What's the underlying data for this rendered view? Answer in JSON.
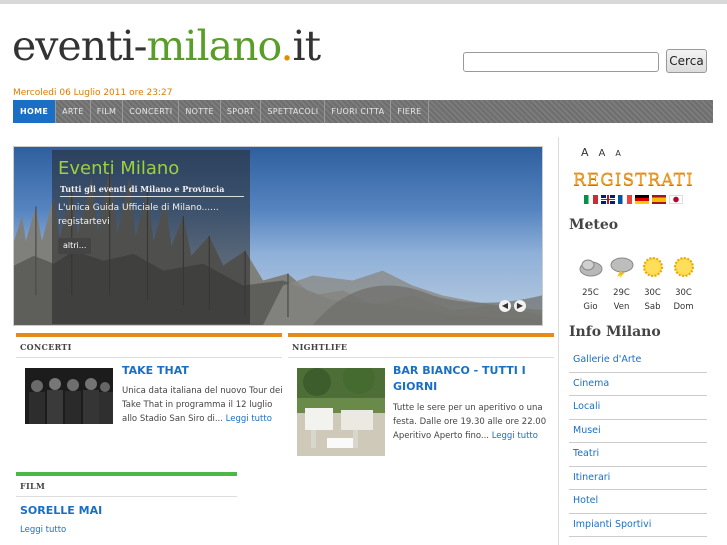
{
  "header": {
    "logo": {
      "part1": "eventi-",
      "part2": "milano",
      "part3": ".",
      "part4": "it"
    },
    "search": {
      "value": "",
      "placeholder": "",
      "button_label": "Cerca"
    },
    "date": "Mercoledi 06 Luglio 2011 ore 23:27"
  },
  "nav": {
    "items": [
      "HOME",
      "ARTE",
      "FILM",
      "CONCERTI",
      "NOTTE",
      "SPORT",
      "SPETTACOLI",
      "FUORI CITTA",
      "FIERE"
    ],
    "active": "HOME"
  },
  "slider": {
    "title": "Eventi Milano",
    "subtitle": "Tutti gli eventi di Milano e Provincia",
    "text": "L'unica Guida Ufficiale di Milano...... registartevi",
    "more_label": "altri...",
    "prev_icon": "◀",
    "next_icon": "▶"
  },
  "sections": {
    "concerti": {
      "heading": "CONCERTI",
      "color": "#e88a1a",
      "title": "TAKE THAT",
      "text": "Unica data italiana del nuovo Tour dei Take That in programma il 12 luglio allo Stadio San Siro di...",
      "more": "Leggi tutto"
    },
    "nightlife": {
      "heading": "NIGHTLIFE",
      "color": "#e88a1a",
      "title": "BAR BIANCO - TUTTI I GIORNI",
      "text": "Tutte le sere per un aperitivo o una festa. Dalle ore 19.30 alle ore 22.00 Aperitivo Aperto fino...",
      "more": "Leggi tutto"
    },
    "film": {
      "heading": "FILM",
      "color": "#4cb848",
      "title": "SORELLE MAI",
      "more": "Leggi tutto"
    }
  },
  "sidebar": {
    "font_sizes": [
      "A",
      "A",
      "A"
    ],
    "registrati": "REGISTRATI",
    "flags": [
      "Italiano",
      "English",
      "Français",
      "Deutsch",
      "Español",
      "日本語"
    ],
    "meteo_title": "Meteo",
    "weather": [
      {
        "temp": "25C",
        "day": "Gio",
        "icon": "cloud-icon"
      },
      {
        "temp": "29C",
        "day": "Ven",
        "icon": "storm-icon"
      },
      {
        "temp": "30C",
        "day": "Sab",
        "icon": "sun-icon"
      },
      {
        "temp": "30C",
        "day": "Dom",
        "icon": "sun-icon"
      }
    ],
    "info_title": "Info Milano",
    "info_items": [
      "Gallerie d'Arte",
      "Cinema",
      "Locali",
      "Musei",
      "Teatri",
      "Itinerari",
      "Hotel",
      "Impianti Sportivi"
    ]
  }
}
